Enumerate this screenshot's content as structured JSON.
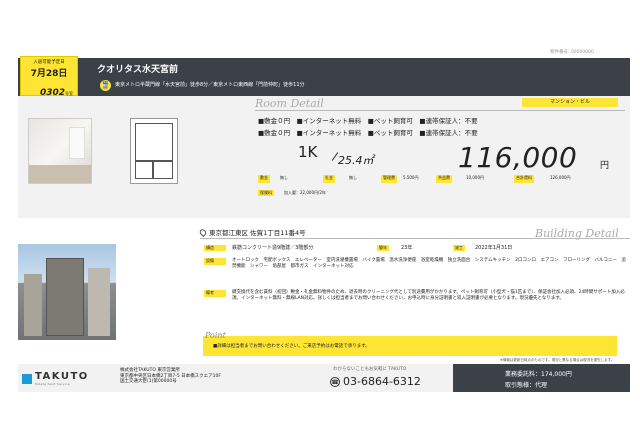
{
  "top_note": "物件番号: 00000000",
  "date_box": {
    "label": "入居可能予定日",
    "date": "7月28日",
    "room": "0302",
    "room_suffix": "号室"
  },
  "header": {
    "title": "クオリタス水天宮前",
    "access": "東京メトロ半蔵門線「水天宮前」徒歩8分／東京メトロ東西線「門前仲町」徒歩11分",
    "train_icon": "train-icon"
  },
  "room_detail": {
    "title": "Room Detail",
    "type_badge": "マンション・ビル",
    "features_line1": "■敷金０円　■インターネット無料　■ペット飼育可　■連帯保証人：不要",
    "features_line2": "■敷金０円　■インターネット無料　■ペット飼育可　■連帯保証人：不要",
    "layout": "1K",
    "area": "25.4㎡",
    "price": "116,000",
    "price_unit": "円",
    "fee_row": [
      {
        "label": "敷金",
        "value": "無し"
      },
      {
        "label": "礼金",
        "value": "無し"
      },
      {
        "label": "管理費",
        "value": "5,500円"
      },
      {
        "label": "共益費",
        "value": "10,000円"
      },
      {
        "label": "合計賃料",
        "value": "126,000円"
      }
    ],
    "insurance_label": "保険料",
    "insurance_value": "加入要：22,000円/2年"
  },
  "building": {
    "address": "東京都江東区 佐賀1丁目11番4号",
    "title": "Building Detail",
    "structure_label": "構造",
    "structure_value": "鉄筋コンクリート造9階建／3階部分",
    "built_label": "築年",
    "built_value": "23年",
    "completed_label": "竣工",
    "completed_value": "2022年1月31日",
    "equipment_label": "設備",
    "equipment_value": "オートロック　宅配ボックス　エレベーター　室内洗濯機置場　バイク置場　温水洗浄便座　浴室乾燥機　独立洗面台　システムキッチン　2口コンロ　エアコン　フローリング　バルコニー　追焚機能　シャワー　角部屋　都市ガス　インターネット対応",
    "notes_label": "備考",
    "notes_value": "鍵交換代を含む賃料（初回）敷金・礼金無料物件のため、退去時のクリーニング代として別途費用がかかります。ペット飼育可（小型犬・猫1匹まで）、保証会社加入必須、24時間サポート加入必須。インターネット無料・無線LAN対応。詳しくは担当者までお問い合わせください。お申込時に身分証明書と収入証明書が必要となります。現況優先となります。"
  },
  "point": {
    "title": "Point",
    "text": "■詳細は担当者までお問い合わせください。ご来店予約はお電話で承ります。"
  },
  "footer_note": "※情報は更新日時点のものです。現況と異なる場合は現況を優先します。",
  "footer": {
    "logo": "TAKUTO",
    "logo_sub": "Estate Rent Service",
    "company": "株式会社TAKUTO 東京営業所",
    "company_address": "東京都中央区日本橋2丁目7-5 日本橋スクエア10F",
    "license": "国土交通大臣(1)第00000号",
    "phone_lead": "わからないこともお気軽に TAKUTO",
    "phone": "03-6864-6312",
    "fee_label": "業務委託料：",
    "fee_value": "174,000円",
    "deal_label": "取引態様：",
    "deal_value": "代理"
  }
}
